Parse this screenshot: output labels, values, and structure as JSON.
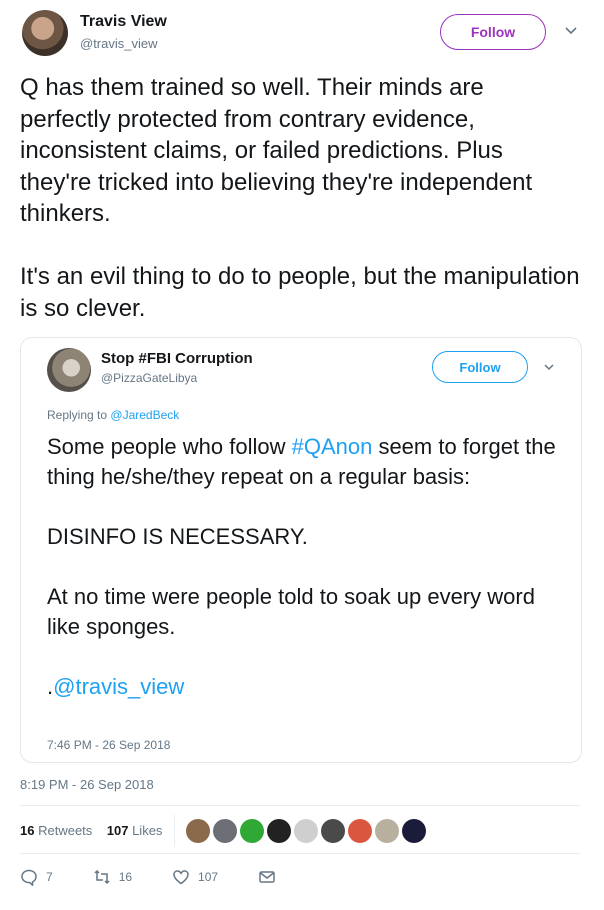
{
  "author": {
    "name": "Travis View",
    "handle": "@travis_view",
    "follow_label": "Follow"
  },
  "tweet": {
    "text": "Q has them trained so well. Their minds are perfectly protected from contrary evidence, inconsistent claims, or failed predictions. Plus they're tricked into believing they're independent thinkers.\n\nIt's an evil thing to do to people, but the manipulation is so clever.",
    "timestamp": "8:19 PM - 26 Sep 2018"
  },
  "quoted": {
    "name": "Stop #FBI Corruption",
    "handle": "@PizzaGateLibya",
    "follow_label": "Follow",
    "replying_prefix": "Replying to",
    "replying_to": "@JaredBeck",
    "line1_pre": "Some people who follow ",
    "line1_hashtag": "#QAnon",
    "line1_post": " seem to forget the thing he/she/they repeat on a regular basis:",
    "line2": "DISINFO IS NECESSARY.",
    "line3": "At no time were people told to soak up every word like sponges.",
    "line4_pre": ".",
    "line4_link": "@travis_view",
    "timestamp": "7:46 PM - 26 Sep 2018"
  },
  "stats": {
    "retweets_count": "16",
    "retweets_label": "Retweets",
    "likes_count": "107",
    "likes_label": "Likes"
  },
  "likers": [
    {
      "color": "#8a6a4a"
    },
    {
      "color": "#6b6f75"
    },
    {
      "color": "#2fa836"
    },
    {
      "color": "#222222"
    },
    {
      "color": "#cfcfcf"
    },
    {
      "color": "#4a4a4a"
    },
    {
      "color": "#d9573f"
    },
    {
      "color": "#b7b09e"
    },
    {
      "color": "#1b1b3a"
    }
  ],
  "actions": {
    "reply_count": "7",
    "retweet_count": "16",
    "like_count": "107"
  },
  "colors": {
    "accent_follow": "#9c33bd",
    "link_blue": "#1da1f2",
    "muted": "#657786"
  }
}
